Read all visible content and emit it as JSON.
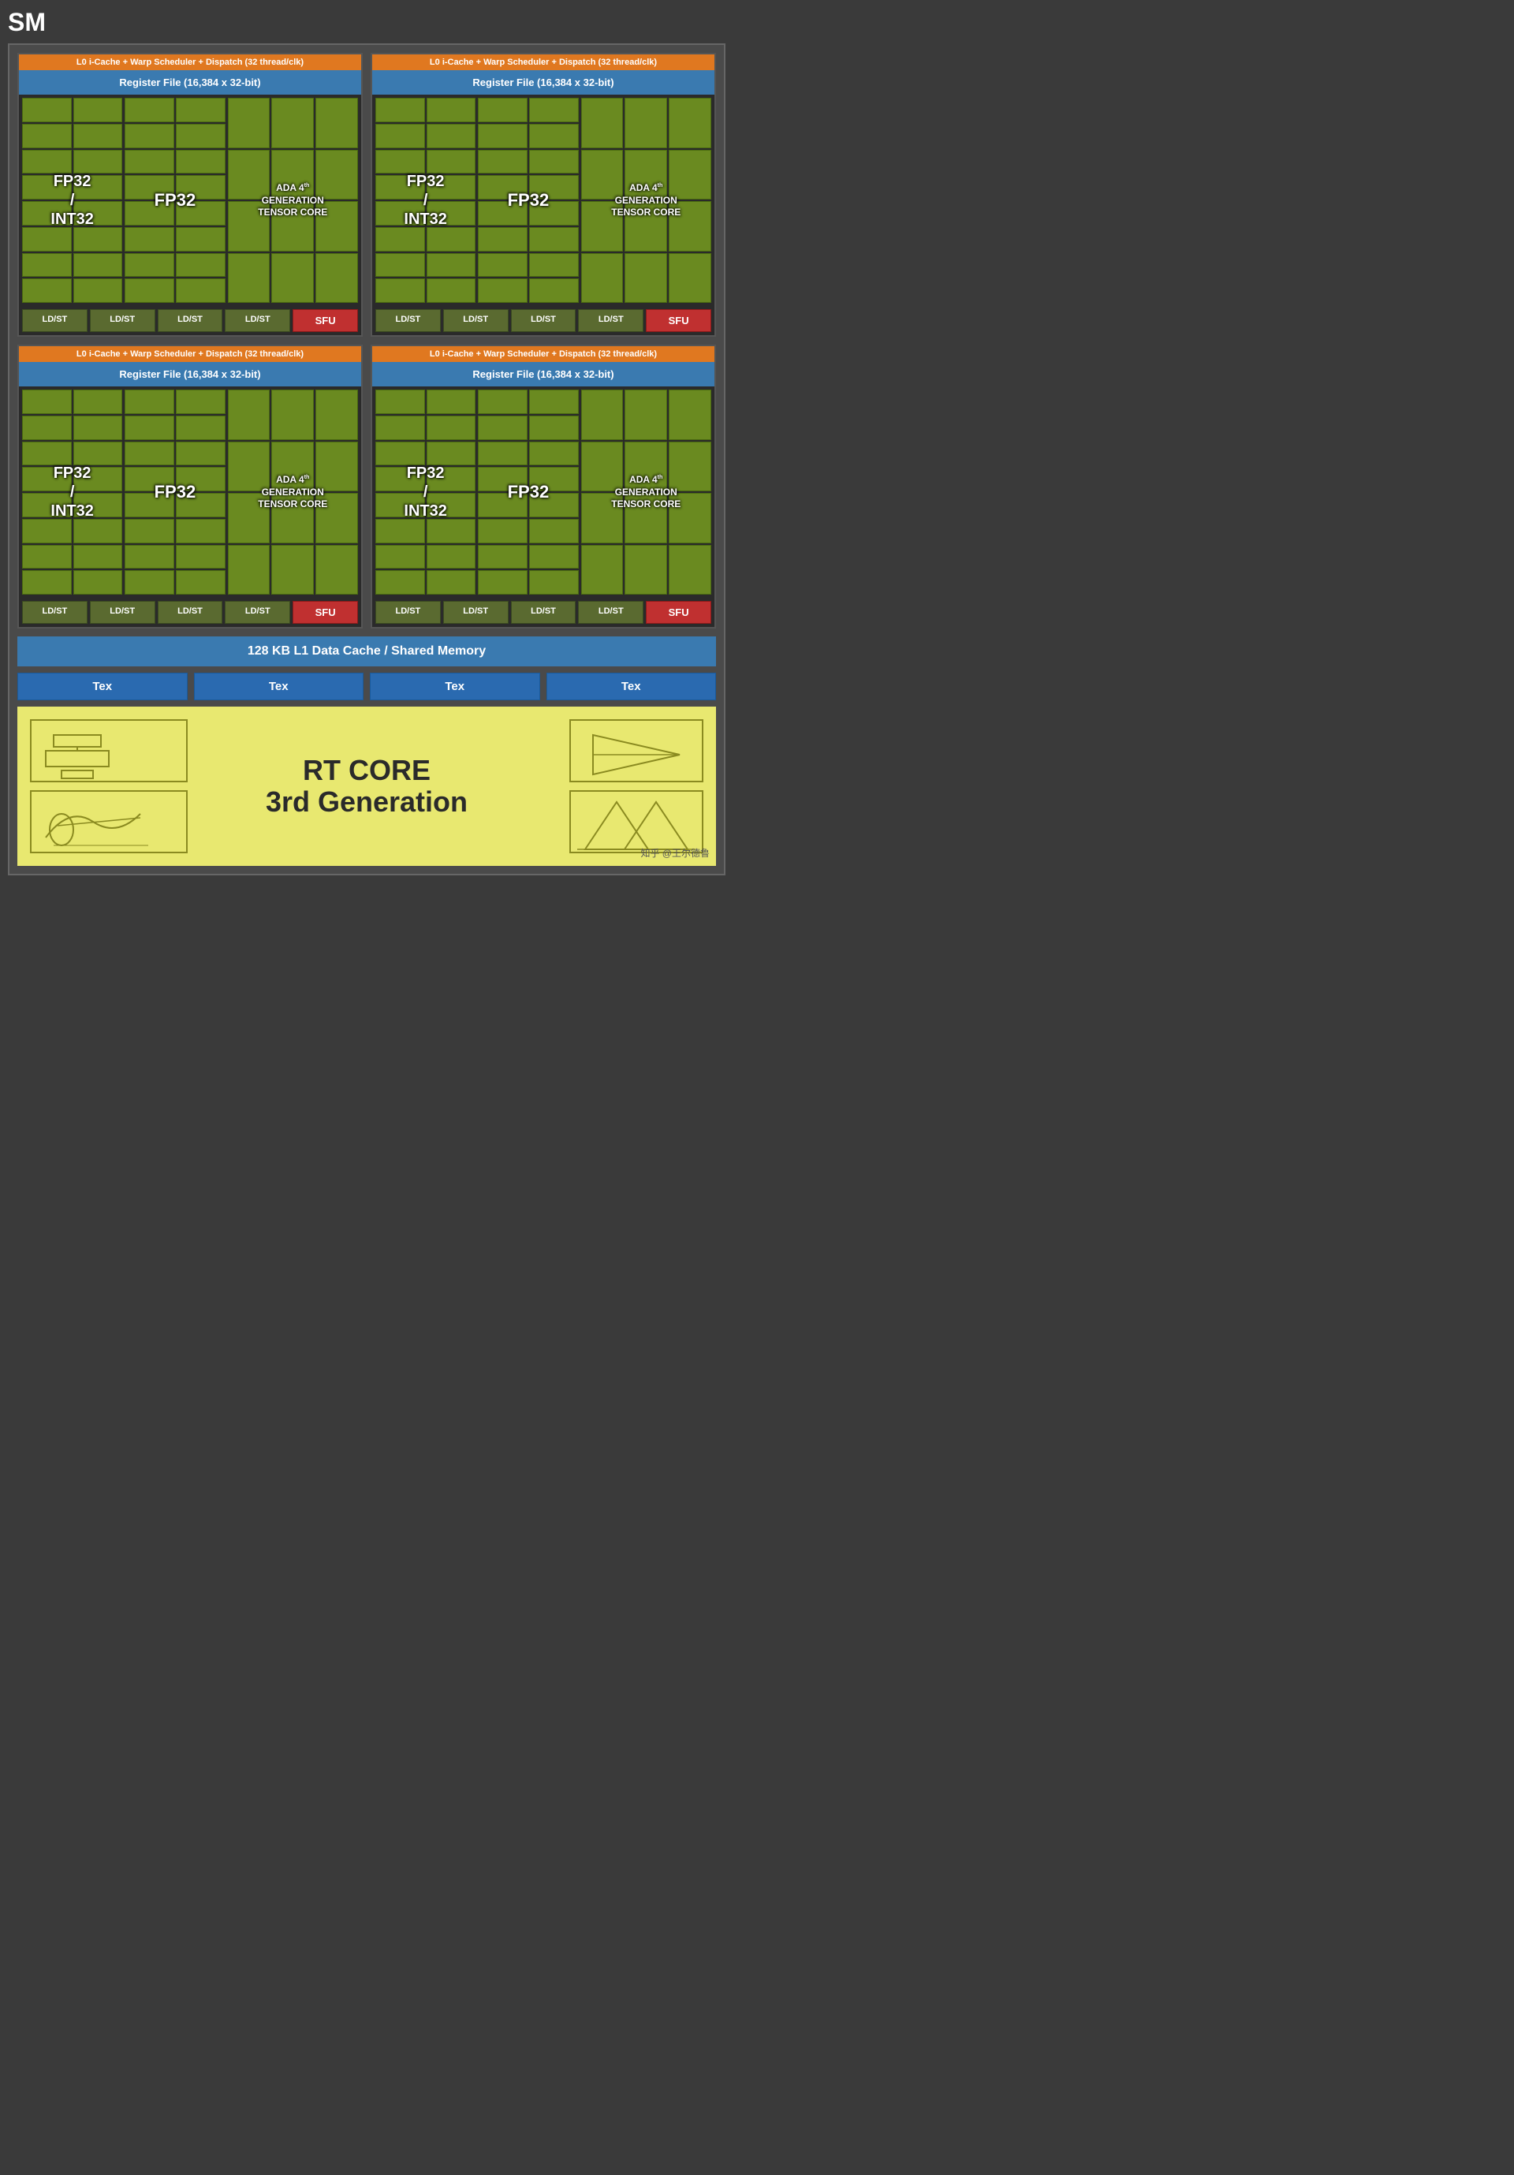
{
  "sm_label": "SM",
  "quadrants": [
    {
      "warp_header": "L0 i-Cache + Warp Scheduler + Dispatch (32 thread/clk)",
      "register_file": "Register File (16,384 x 32-bit)",
      "col1_label": "FP32\n/\nINT32",
      "col2_label": "FP32",
      "col3_label_line1": "ADA 4",
      "col3_label_sup": "th",
      "col3_label_line2": "GENERATION",
      "col3_label_line3": "TENSOR CORE",
      "ldst_labels": [
        "LD/ST",
        "LD/ST",
        "LD/ST",
        "LD/ST"
      ],
      "sfu_label": "SFU"
    },
    {
      "warp_header": "L0 i-Cache + Warp Scheduler + Dispatch (32 thread/clk)",
      "register_file": "Register File (16,384 x 32-bit)",
      "col1_label": "FP32\n/\nINT32",
      "col2_label": "FP32",
      "col3_label_line1": "ADA 4",
      "col3_label_sup": "th",
      "col3_label_line2": "GENERATION",
      "col3_label_line3": "TENSOR CORE",
      "ldst_labels": [
        "LD/ST",
        "LD/ST",
        "LD/ST",
        "LD/ST"
      ],
      "sfu_label": "SFU"
    },
    {
      "warp_header": "L0 i-Cache + Warp Scheduler + Dispatch (32 thread/clk)",
      "register_file": "Register File (16,384 x 32-bit)",
      "col1_label": "FP32\n/\nINT32",
      "col2_label": "FP32",
      "col3_label_line1": "ADA 4",
      "col3_label_sup": "th",
      "col3_label_line2": "GENERATION",
      "col3_label_line3": "TENSOR CORE",
      "ldst_labels": [
        "LD/ST",
        "LD/ST",
        "LD/ST",
        "LD/ST"
      ],
      "sfu_label": "SFU"
    },
    {
      "warp_header": "L0 i-Cache + Warp Scheduler + Dispatch (32 thread/clk)",
      "register_file": "Register File (16,384 x 32-bit)",
      "col1_label": "FP32\n/\nINT32",
      "col2_label": "FP32",
      "col3_label_line1": "ADA 4",
      "col3_label_sup": "th",
      "col3_label_line2": "GENERATION",
      "col3_label_line3": "TENSOR CORE",
      "ldst_labels": [
        "LD/ST",
        "LD/ST",
        "LD/ST",
        "LD/ST"
      ],
      "sfu_label": "SFU"
    }
  ],
  "l1_cache": "128 KB L1 Data Cache / Shared Memory",
  "tex_labels": [
    "Tex",
    "Tex",
    "Tex",
    "Tex"
  ],
  "rt_core_line1": "RT CORE",
  "rt_core_line2": "3rd Generation",
  "watermark": "知乎 @王尔德鲁"
}
